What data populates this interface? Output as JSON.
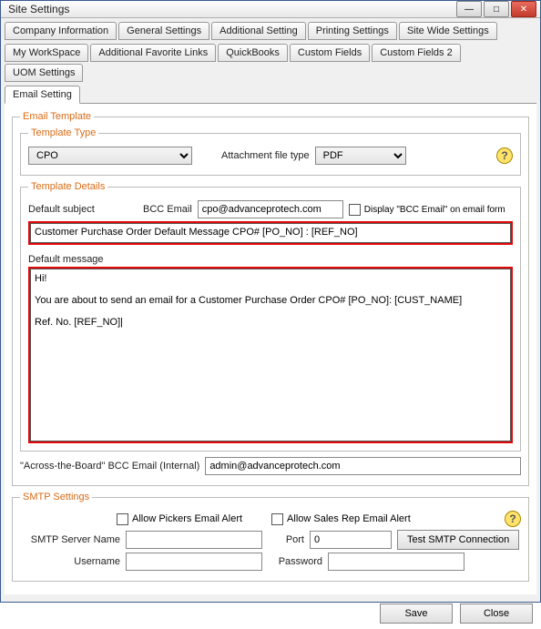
{
  "window": {
    "title": "Site Settings"
  },
  "tabs_row1": [
    "Company Information",
    "General Settings",
    "Additional Setting",
    "Printing Settings",
    "Site Wide Settings"
  ],
  "tabs_row2": [
    "My WorkSpace",
    "Additional Favorite Links",
    "QuickBooks",
    "Custom Fields",
    "Custom Fields 2",
    "UOM Settings"
  ],
  "tabs_row3": [
    "Email Setting"
  ],
  "email_template": {
    "legend": "Email Template",
    "type_legend": "Template Type",
    "template_type_value": "CPO",
    "attachment_label": "Attachment file type",
    "attachment_value": "PDF",
    "details_legend": "Template Details",
    "default_subject_label": "Default subject",
    "bcc_email_label": "BCC Email",
    "bcc_email_value": "cpo@advanceprotech.com",
    "display_bcc_label": "Display \"BCC Email\" on email form",
    "subject_value": "Customer Purchase Order Default Message CPO# [PO_NO] : [REF_NO]",
    "default_message_label": "Default message",
    "message_value": "Hi!\n\nYou are about to send an email for a Customer Purchase Order CPO# [PO_NO]: [CUST_NAME]\n\nRef. No. [REF_NO]|",
    "across_label": "\"Across-the-Board\" BCC Email (Internal)",
    "across_value": "admin@advanceprotech.com"
  },
  "smtp": {
    "legend": "SMTP Settings",
    "allow_pickers": "Allow Pickers Email Alert",
    "allow_salesrep": "Allow Sales Rep Email Alert",
    "server_label": "SMTP Server Name",
    "server_value": "",
    "port_label": "Port",
    "port_value": "0",
    "test_button": "Test SMTP Connection",
    "username_label": "Username",
    "username_value": "",
    "password_label": "Password",
    "password_value": ""
  },
  "buttons": {
    "save": "Save",
    "close": "Close"
  }
}
